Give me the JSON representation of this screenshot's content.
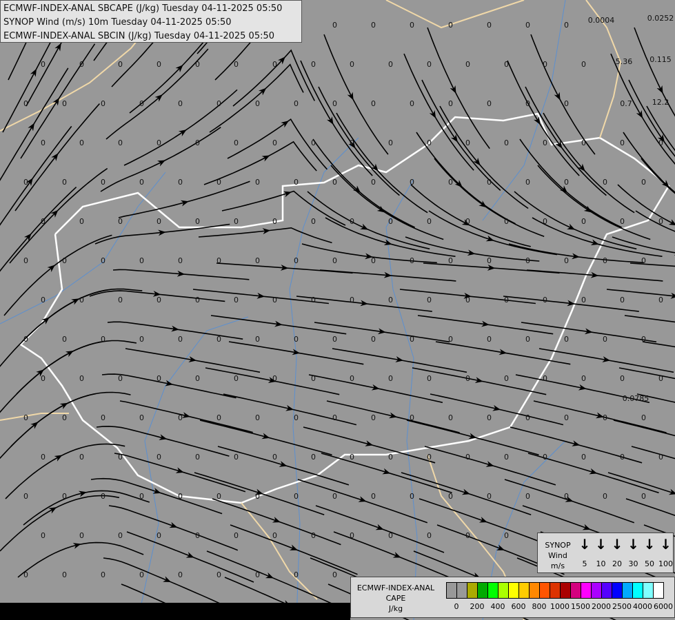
{
  "header": {
    "lines": [
      "ECMWF-INDEX-ANAL SBCAPE (J/kg) Tuesday 04-11-2025 05:50",
      "SYNOP Wind (m/s) 10m Tuesday 04-11-2025 05:50",
      "ECMWF-INDEX-ANAL SBCIN (J/kg) Tuesday 04-11-2025 05:50"
    ]
  },
  "map": {
    "background": "#989898",
    "grid_value": "0",
    "special_values": [
      "0.0004",
      "0.0252",
      "5.36",
      "0.115",
      "0.7",
      "12.2",
      "0.0785"
    ],
    "colors": {
      "border_country": "#f0d8a8",
      "border_highlight": "#ffffff",
      "river": "#5b8fd0",
      "streamline": "#000000"
    }
  },
  "wind_legend": {
    "title": [
      "SYNOP",
      "Wind",
      "m/s"
    ],
    "speeds": [
      "5",
      "10",
      "20",
      "30",
      "50",
      "100"
    ]
  },
  "cape_legend": {
    "title": [
      "ECMWF-INDEX-ANAL",
      "CAPE",
      "J/kg"
    ],
    "colors": [
      "#999999",
      "#999999",
      "#aaaa00",
      "#00aa00",
      "#00ff00",
      "#aaff00",
      "#ffff00",
      "#ffcc00",
      "#ff8800",
      "#ff5500",
      "#dd3300",
      "#aa0000",
      "#d4007f",
      "#ff00ff",
      "#aa00ff",
      "#5500ff",
      "#0000ff",
      "#00aaff",
      "#00ffff",
      "#80ffff",
      "#ffffff"
    ],
    "ticks": [
      "0",
      "200",
      "400",
      "600",
      "800",
      "1000",
      "1500",
      "2000",
      "2500",
      "4000",
      "6000"
    ]
  }
}
